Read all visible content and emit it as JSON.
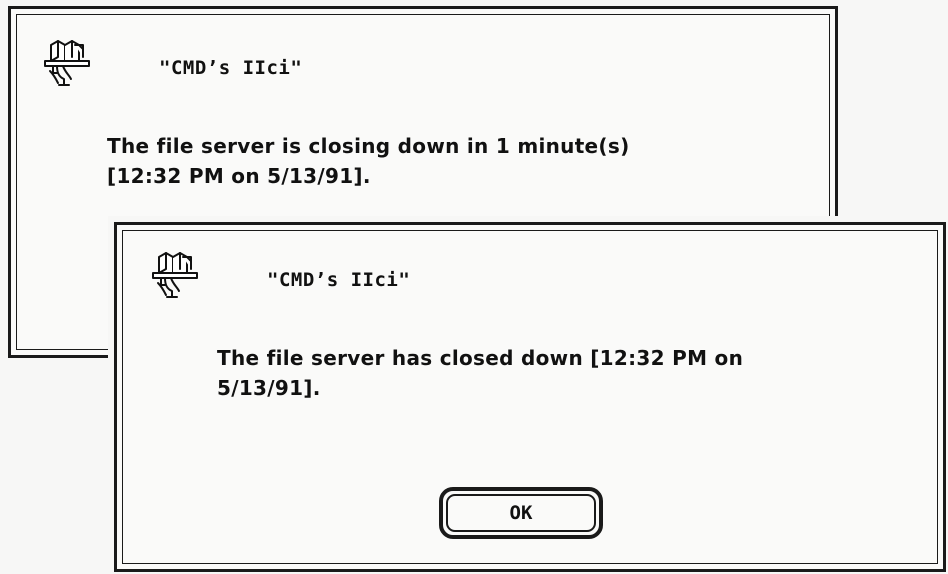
{
  "dialogs": [
    {
      "server_name": "\"CMD’s IIci\"",
      "icon": "file-server-icon",
      "message_lines": [
        "The file server is closing down in  1 minute(s)",
        "[12:32 PM on 5/13/91]."
      ]
    },
    {
      "server_name": "\"CMD’s IIci\"",
      "icon": "file-server-icon",
      "message_lines": [
        "The file server has closed down [12:32 PM on",
        "5/13/91]."
      ],
      "ok_label": "OK"
    }
  ]
}
